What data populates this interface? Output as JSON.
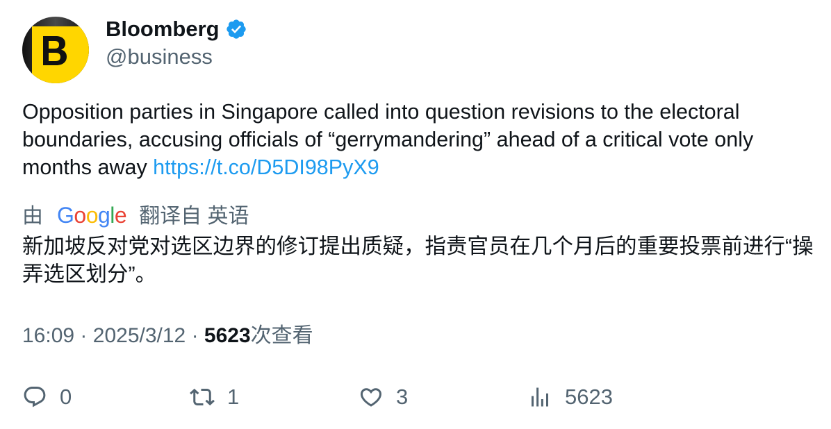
{
  "author": {
    "name": "Bloomberg",
    "handle": "@business",
    "avatar_letter": "B",
    "avatar_color": "#FFD600",
    "verified": true,
    "verified_color": "#1d9bf0"
  },
  "tweet": {
    "text": "Opposition parties in Singapore called into question revisions to the electoral boundaries, accusing officials of “gerrymandering” ahead of a critical vote only months away ",
    "link": "https://t.co/D5DI98PyX9"
  },
  "translation": {
    "prefix": "由",
    "provider": "Google",
    "label": "翻译自 英语",
    "text": "新加坡反对党对选区边界的修订提出质疑，指责官员在几个月后的重要投票前进行“操弄选区划分”。"
  },
  "meta": {
    "time": "16:09",
    "separator": "·",
    "date": "2025/3/12",
    "views_count": "5623",
    "views_label": "次查看"
  },
  "actions": {
    "reply": {
      "icon": "reply-icon",
      "count": "0"
    },
    "retweet": {
      "icon": "retweet-icon",
      "count": "1"
    },
    "like": {
      "icon": "heart-icon",
      "count": "3"
    },
    "views": {
      "icon": "views-icon",
      "count": "5623"
    }
  }
}
